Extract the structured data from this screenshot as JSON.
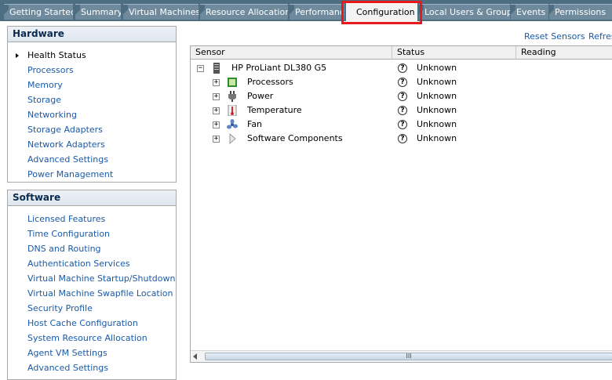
{
  "tabs": [
    {
      "label": "Getting Started"
    },
    {
      "label": "Summary"
    },
    {
      "label": "Virtual Machines"
    },
    {
      "label": "Resource Allocation"
    },
    {
      "label": "Performance"
    },
    {
      "label": "Configuration"
    },
    {
      "label": "Local Users & Groups"
    },
    {
      "label": "Events"
    },
    {
      "label": "Permissions"
    }
  ],
  "hardware": {
    "title": "Hardware",
    "items": [
      "Health Status",
      "Processors",
      "Memory",
      "Storage",
      "Networking",
      "Storage Adapters",
      "Network Adapters",
      "Advanced Settings",
      "Power Management"
    ]
  },
  "software": {
    "title": "Software",
    "items": [
      "Licensed Features",
      "Time Configuration",
      "DNS and Routing",
      "Authentication Services",
      "Virtual Machine Startup/Shutdown",
      "Virtual Machine Swapfile Location",
      "Security Profile",
      "Host Cache Configuration",
      "System Resource Allocation",
      "Agent VM Settings",
      "Advanced Settings"
    ]
  },
  "actions": {
    "reset_sensors": "Reset Sensors",
    "refresh": "Refresh"
  },
  "grid": {
    "columns": {
      "sensor": "Sensor",
      "status": "Status",
      "reading": "Reading"
    },
    "rows": [
      {
        "expander": "−",
        "label": "HP ProLiant DL380 G5",
        "status": "Unknown",
        "icon": "server-icon"
      },
      {
        "expander": "+",
        "label": "Processors",
        "status": "Unknown",
        "icon": "processor-icon"
      },
      {
        "expander": "+",
        "label": "Power",
        "status": "Unknown",
        "icon": "power-plug-icon"
      },
      {
        "expander": "+",
        "label": "Temperature",
        "status": "Unknown",
        "icon": "thermometer-icon"
      },
      {
        "expander": "+",
        "label": "Fan",
        "status": "Unknown",
        "icon": "fan-icon"
      },
      {
        "expander": "+",
        "label": "Software Components",
        "status": "Unknown",
        "icon": "software-components-icon"
      }
    ],
    "status_icon": "?",
    "scroll_grip": "III"
  }
}
